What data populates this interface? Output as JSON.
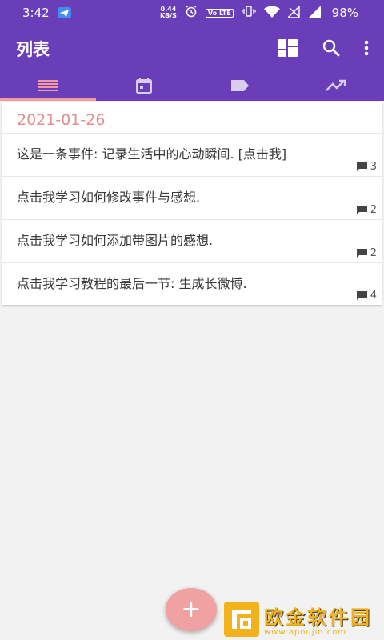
{
  "status_bar": {
    "time": "3:42",
    "net_speed_value": "0.44",
    "net_speed_unit": "KB/S",
    "volte": "Vo LTE",
    "battery": "98%"
  },
  "app_bar": {
    "title": "列表",
    "actions": [
      "dashboard-icon",
      "search-icon",
      "more-vert-icon"
    ]
  },
  "tabs": [
    {
      "icon": "list-icon",
      "active": true
    },
    {
      "icon": "calendar-icon",
      "active": false
    },
    {
      "icon": "label-icon",
      "active": false
    },
    {
      "icon": "trending-up-icon",
      "active": false
    }
  ],
  "date_group": {
    "date": "2021-01-26",
    "events": [
      {
        "text": "这是一条事件: 记录生活中的心动瞬间. [点击我]",
        "comments": "3"
      },
      {
        "text": "点击我学习如何修改事件与感想.",
        "comments": "2"
      },
      {
        "text": "点击我学习如何添加带图片的感想.",
        "comments": "2"
      },
      {
        "text": "点击我学习教程的最后一节: 生成长微博.",
        "comments": "4"
      }
    ]
  },
  "fab": {
    "label": "+"
  },
  "watermark": {
    "title": "欧金软件园",
    "url": "www.apoujin.com"
  },
  "colors": {
    "primary": "#6a3eb8",
    "accent": "#f0a2a2",
    "date": "#e58c8c"
  }
}
